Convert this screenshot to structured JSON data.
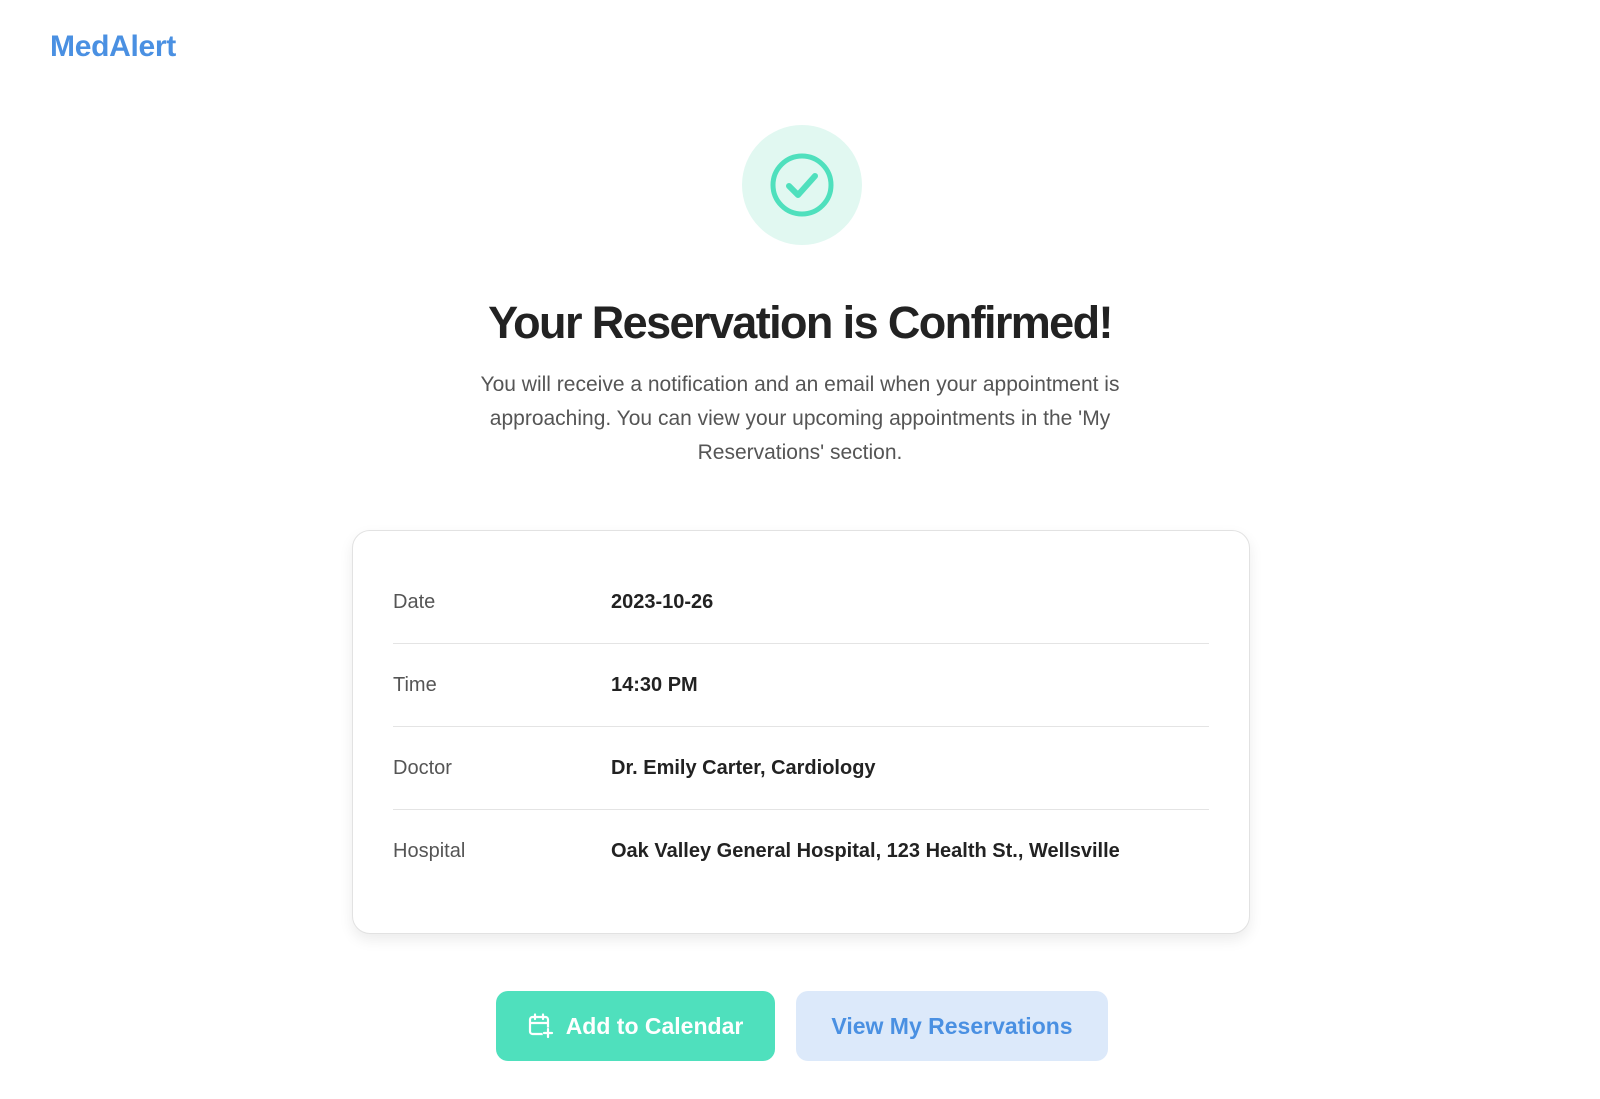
{
  "header": {
    "logo": "MedAlert"
  },
  "confirmation": {
    "icon": "check-circle-icon",
    "title": "Your Reservation is Confirmed!",
    "message": "You will receive a notification and an email when your appointment is approaching. You can view your upcoming appointments in the 'My Reservations' section."
  },
  "details": {
    "rows": [
      {
        "label": "Date",
        "value": "2023-10-26"
      },
      {
        "label": "Time",
        "value": "14:30 PM"
      },
      {
        "label": "Doctor",
        "value": "Dr. Emily Carter, Cardiology"
      },
      {
        "label": "Hospital",
        "value": "Oak Valley General Hospital, 123 Health St., Wellsville"
      }
    ]
  },
  "actions": {
    "add_calendar_label": "Add to Calendar",
    "add_calendar_icon": "calendar-plus-icon",
    "view_reservations_label": "View My Reservations"
  },
  "colors": {
    "brand": "#4a90e2",
    "accent": "#4fe0bd",
    "accent_light": "#e1f8f1",
    "secondary_bg": "#dce9fa"
  }
}
